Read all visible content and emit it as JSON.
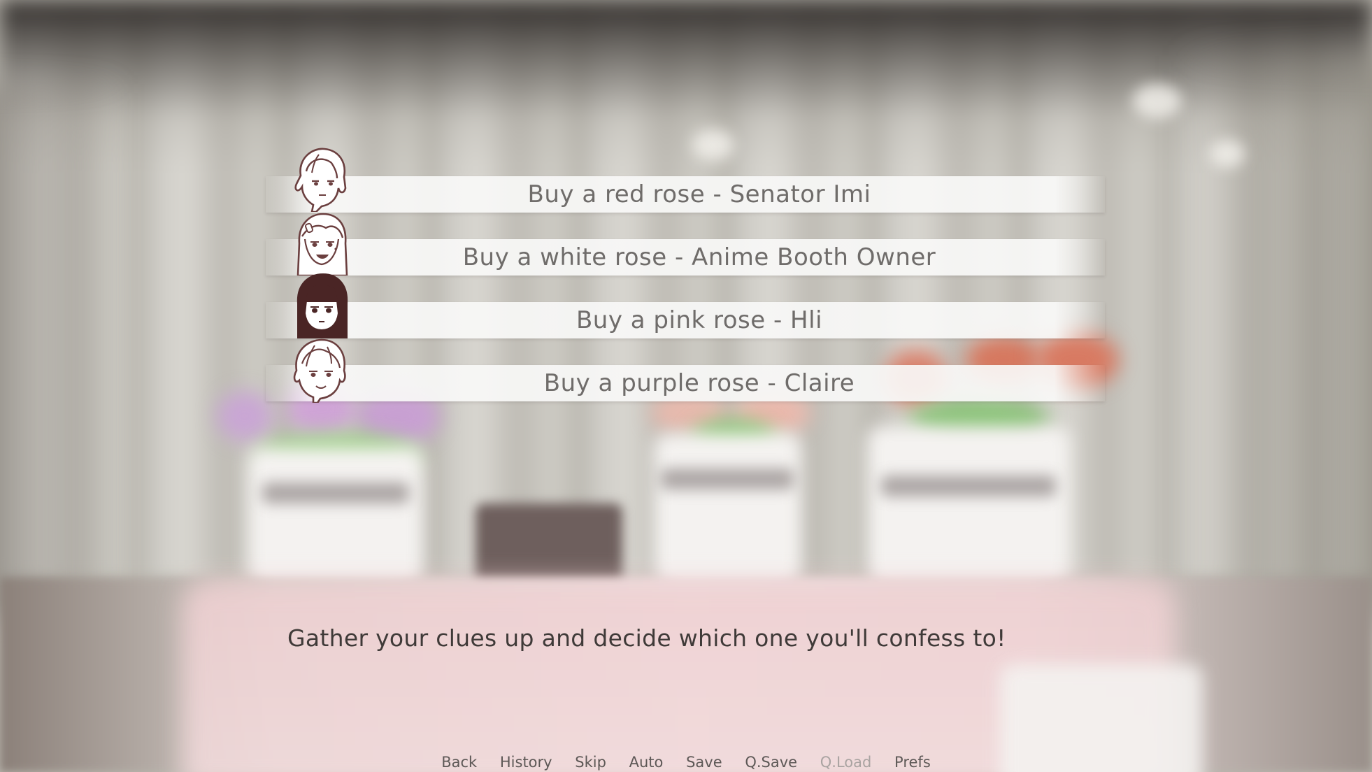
{
  "choices": [
    {
      "label": "Buy a red rose - Senator Imi",
      "portrait_icon": "senator-imi-portrait-icon"
    },
    {
      "label": "Buy a white rose - Anime Booth Owner",
      "portrait_icon": "anime-booth-owner-portrait-icon"
    },
    {
      "label": "Buy a pink rose - Hli",
      "portrait_icon": "hli-portrait-icon"
    },
    {
      "label": "Buy a purple rose - Claire",
      "portrait_icon": "claire-portrait-icon"
    }
  ],
  "dialogue": {
    "text": "Gather your clues up and decide which one you'll confess to!"
  },
  "quick_menu": {
    "back": "Back",
    "history": "History",
    "skip": "Skip",
    "auto": "Auto",
    "save": "Save",
    "qsave": "Q.Save",
    "qload": "Q.Load",
    "prefs": "Prefs"
  },
  "colors": {
    "line_art": "#6b3f3f",
    "hair_dark": "#4a2525",
    "skin": "#ffffff"
  }
}
